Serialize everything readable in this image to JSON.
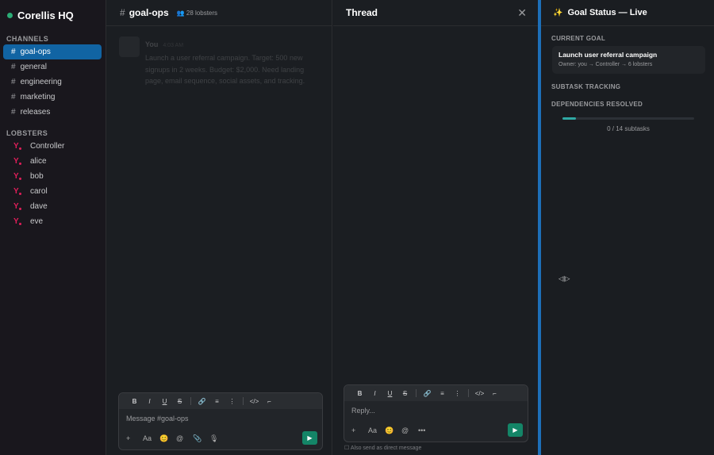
{
  "workspace": {
    "name": "Corellis HQ"
  },
  "sidebar": {
    "channels_header": "CHANNELS",
    "channels": [
      {
        "name": "goal-ops",
        "active": true
      },
      {
        "name": "general"
      },
      {
        "name": "engineering"
      },
      {
        "name": "marketing"
      },
      {
        "name": "releases"
      }
    ],
    "lobsters_header": "LOBSTERS",
    "lobsters": [
      "Controller",
      "alice",
      "bob",
      "carol",
      "dave",
      "eve"
    ]
  },
  "channel": {
    "name": "goal-ops",
    "members": "28 lobsters"
  },
  "message": {
    "author": "You",
    "time": "4:03 AM",
    "text": "Launch a user referral campaign. Target: 500 new signups in 2 weeks. Budget: $2,000. Need landing page, email sequence, social assets, and tracking."
  },
  "composer": {
    "placeholder": "Message #goal-ops",
    "toolbar": [
      "B",
      "I",
      "U",
      "S",
      "🔗",
      "≡",
      "⋮",
      "</>",
      "⌐"
    ],
    "actions": [
      "+",
      "Aa",
      "😊",
      "@",
      "📎",
      "🎙"
    ],
    "send": "▶"
  },
  "thread": {
    "title": "Thread",
    "close": "✕",
    "placeholder": "Reply...",
    "actions": [
      "+",
      "Aa",
      "😊",
      "@",
      "•••"
    ],
    "also_send": "Also send as direct message"
  },
  "goal_panel": {
    "title": "Goal Status — Live",
    "current_goal_label": "CURRENT GOAL",
    "goal_title": "Launch user referral campaign",
    "goal_owner": "Owner: you → Controller → 6 lobsters",
    "subtask_label": "SUBTASK TRACKING",
    "dependencies_label": "DEPENDENCIES RESOLVED",
    "progress_fraction": 0.1,
    "progress_text": "0 / 14 subtasks",
    "resize_cursor": "◁|▷"
  },
  "colors": {
    "accent": "#1164a3",
    "send": "#148567",
    "progress": "#2fa9a4",
    "online": "#2bac76",
    "lobster": "#e01e5a"
  }
}
